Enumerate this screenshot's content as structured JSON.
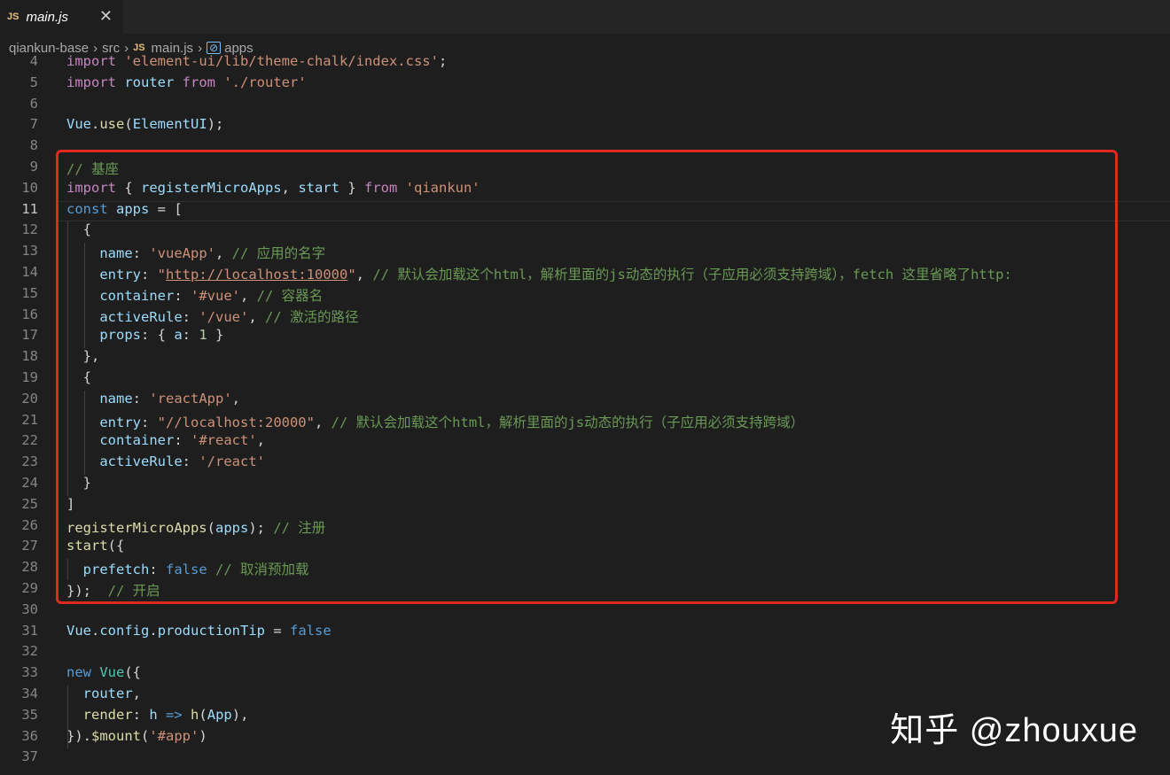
{
  "tab": {
    "icon": "js-icon",
    "title": "main.js",
    "close": "✕"
  },
  "breadcrumb": {
    "root": "qiankun-base",
    "folder": "src",
    "file": "main.js",
    "symbol": "apps",
    "js_label": "JS",
    "symbol_icon": "[⊘]"
  },
  "active_line": 11,
  "watermark": "知乎 @zhouxue",
  "lines": [
    {
      "n": "4",
      "tokens": [
        [
          "imp",
          "import "
        ],
        [
          "str",
          "'element-ui/lib/theme-chalk/index.css'"
        ],
        [
          "def",
          ";"
        ]
      ]
    },
    {
      "n": "5",
      "tokens": [
        [
          "imp",
          "import "
        ],
        [
          "id",
          "router "
        ],
        [
          "imp",
          "from "
        ],
        [
          "str",
          "'./router'"
        ]
      ]
    },
    {
      "n": "6",
      "tokens": []
    },
    {
      "n": "7",
      "tokens": [
        [
          "id",
          "Vue"
        ],
        [
          "def",
          "."
        ],
        [
          "fn",
          "use"
        ],
        [
          "def",
          "("
        ],
        [
          "id",
          "ElementUI"
        ],
        [
          "def",
          ");"
        ]
      ]
    },
    {
      "n": "8",
      "tokens": []
    },
    {
      "n": "9",
      "tokens": [
        [
          "cm",
          "// 基座"
        ]
      ]
    },
    {
      "n": "10",
      "tokens": [
        [
          "imp",
          "import "
        ],
        [
          "def",
          "{ "
        ],
        [
          "id",
          "registerMicroApps"
        ],
        [
          "def",
          ", "
        ],
        [
          "id",
          "start"
        ],
        [
          "def",
          " } "
        ],
        [
          "imp",
          "from "
        ],
        [
          "str",
          "'qiankun'"
        ]
      ]
    },
    {
      "n": "11",
      "tokens": [
        [
          "kw",
          "const "
        ],
        [
          "id",
          "apps"
        ],
        [
          "def",
          " = "
        ],
        [
          "def",
          "["
        ]
      ]
    },
    {
      "n": "12",
      "tokens": [
        [
          "def",
          "  {"
        ]
      ]
    },
    {
      "n": "13",
      "tokens": [
        [
          "def",
          "    "
        ],
        [
          "id",
          "name"
        ],
        [
          "def",
          ": "
        ],
        [
          "str",
          "'vueApp'"
        ],
        [
          "def",
          ", "
        ],
        [
          "cm",
          "// 应用的名字"
        ]
      ]
    },
    {
      "n": "14",
      "tokens": [
        [
          "def",
          "    "
        ],
        [
          "id",
          "entry"
        ],
        [
          "def",
          ": "
        ],
        [
          "str",
          "\""
        ],
        [
          "str",
          "http://localhost:10000"
        ],
        [
          "str",
          "\""
        ],
        [
          "def",
          ", "
        ],
        [
          "cm",
          "// 默认会加载这个html，解析里面的js动态的执行（子应用必须支持跨域），fetch 这里省略了http:"
        ]
      ]
    },
    {
      "n": "15",
      "tokens": [
        [
          "def",
          "    "
        ],
        [
          "id",
          "container"
        ],
        [
          "def",
          ": "
        ],
        [
          "str",
          "'#vue'"
        ],
        [
          "def",
          ", "
        ],
        [
          "cm",
          "// 容器名"
        ]
      ]
    },
    {
      "n": "16",
      "tokens": [
        [
          "def",
          "    "
        ],
        [
          "id",
          "activeRule"
        ],
        [
          "def",
          ": "
        ],
        [
          "str",
          "'/vue'"
        ],
        [
          "def",
          ", "
        ],
        [
          "cm",
          "// 激活的路径"
        ]
      ]
    },
    {
      "n": "17",
      "tokens": [
        [
          "def",
          "    "
        ],
        [
          "id",
          "props"
        ],
        [
          "def",
          ": { "
        ],
        [
          "id",
          "a"
        ],
        [
          "def",
          ": "
        ],
        [
          "num",
          "1"
        ],
        [
          "def",
          " }"
        ]
      ]
    },
    {
      "n": "18",
      "tokens": [
        [
          "def",
          "  },"
        ]
      ]
    },
    {
      "n": "19",
      "tokens": [
        [
          "def",
          "  {"
        ]
      ]
    },
    {
      "n": "20",
      "tokens": [
        [
          "def",
          "    "
        ],
        [
          "id",
          "name"
        ],
        [
          "def",
          ": "
        ],
        [
          "str",
          "'reactApp'"
        ],
        [
          "def",
          ","
        ]
      ]
    },
    {
      "n": "21",
      "tokens": [
        [
          "def",
          "    "
        ],
        [
          "id",
          "entry"
        ],
        [
          "def",
          ": "
        ],
        [
          "str",
          "\"//localhost:20000\""
        ],
        [
          "def",
          ", "
        ],
        [
          "cm",
          "// 默认会加载这个html，解析里面的js动态的执行（子应用必须支持跨域）"
        ]
      ]
    },
    {
      "n": "22",
      "tokens": [
        [
          "def",
          "    "
        ],
        [
          "id",
          "container"
        ],
        [
          "def",
          ": "
        ],
        [
          "str",
          "'#react'"
        ],
        [
          "def",
          ","
        ]
      ]
    },
    {
      "n": "23",
      "tokens": [
        [
          "def",
          "    "
        ],
        [
          "id",
          "activeRule"
        ],
        [
          "def",
          ": "
        ],
        [
          "str",
          "'/react'"
        ]
      ]
    },
    {
      "n": "24",
      "tokens": [
        [
          "def",
          "  }"
        ]
      ]
    },
    {
      "n": "25",
      "tokens": [
        [
          "def",
          "]"
        ]
      ]
    },
    {
      "n": "26",
      "tokens": [
        [
          "fn",
          "registerMicroApps"
        ],
        [
          "def",
          "("
        ],
        [
          "id",
          "apps"
        ],
        [
          "def",
          "); "
        ],
        [
          "cm",
          "// 注册"
        ]
      ]
    },
    {
      "n": "27",
      "tokens": [
        [
          "fn",
          "start"
        ],
        [
          "def",
          "({"
        ]
      ]
    },
    {
      "n": "28",
      "tokens": [
        [
          "def",
          "  "
        ],
        [
          "id",
          "prefetch"
        ],
        [
          "def",
          ": "
        ],
        [
          "kw",
          "false"
        ],
        [
          "def",
          " "
        ],
        [
          "cm",
          "// 取消预加载"
        ]
      ]
    },
    {
      "n": "29",
      "tokens": [
        [
          "def",
          "});  "
        ],
        [
          "cm",
          "// 开启"
        ]
      ]
    },
    {
      "n": "30",
      "tokens": []
    },
    {
      "n": "31",
      "tokens": [
        [
          "id",
          "Vue"
        ],
        [
          "def",
          "."
        ],
        [
          "id",
          "config"
        ],
        [
          "def",
          "."
        ],
        [
          "id",
          "productionTip"
        ],
        [
          "def",
          " = "
        ],
        [
          "kw",
          "false"
        ]
      ]
    },
    {
      "n": "32",
      "tokens": []
    },
    {
      "n": "33",
      "tokens": [
        [
          "kw",
          "new "
        ],
        [
          "cls",
          "Vue"
        ],
        [
          "def",
          "({"
        ]
      ]
    },
    {
      "n": "34",
      "tokens": [
        [
          "def",
          "  "
        ],
        [
          "id",
          "router"
        ],
        [
          "def",
          ","
        ]
      ]
    },
    {
      "n": "35",
      "tokens": [
        [
          "def",
          "  "
        ],
        [
          "fn",
          "render"
        ],
        [
          "def",
          ": "
        ],
        [
          "id",
          "h"
        ],
        [
          "def",
          " "
        ],
        [
          "kw",
          "=>"
        ],
        [
          "def",
          " "
        ],
        [
          "fn",
          "h"
        ],
        [
          "def",
          "("
        ],
        [
          "id",
          "App"
        ],
        [
          "def",
          "),"
        ]
      ]
    },
    {
      "n": "36",
      "tokens": [
        [
          "def",
          "})."
        ],
        [
          "fn",
          "$mount"
        ],
        [
          "def",
          "("
        ],
        [
          "str",
          "'#app'"
        ],
        [
          "def",
          ")"
        ]
      ]
    },
    {
      "n": "37",
      "tokens": []
    }
  ]
}
